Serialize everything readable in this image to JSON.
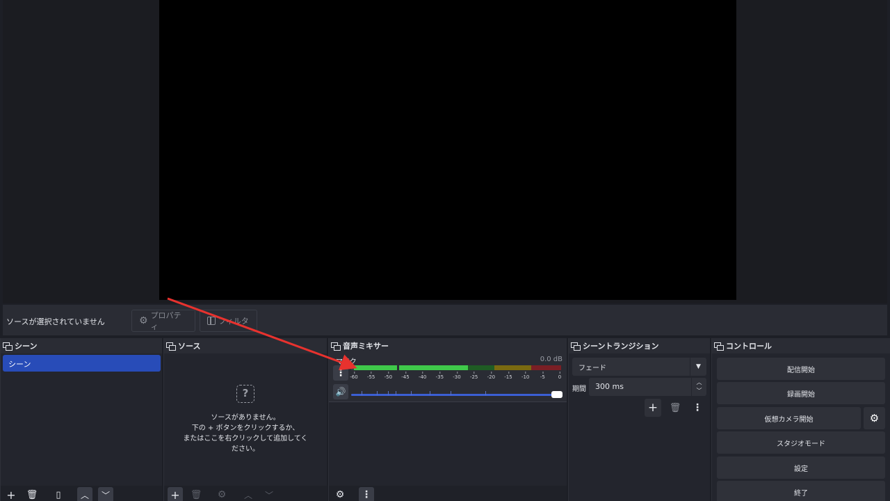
{
  "context_bar": {
    "no_source_text": "ソースが選択されていません",
    "properties_label": "プロパティ",
    "filters_label": "フィルタ"
  },
  "docks": {
    "scenes": {
      "title": "シーン",
      "items": [
        "シーン"
      ]
    },
    "sources": {
      "title": "ソース",
      "empty_lines": [
        "ソースがありません。",
        "下の + ボタンをクリックするか、",
        "またはここを右クリックして追加してく",
        "ださい。"
      ]
    },
    "mixer": {
      "title": "音声ミキサー",
      "channel": {
        "name": "マイク",
        "db": "0.0 dB",
        "volume_percent": 100
      },
      "ticks": [
        "-60",
        "-55",
        "-50",
        "-45",
        "-40",
        "-35",
        "-30",
        "-25",
        "-20",
        "-15",
        "-10",
        "-5",
        "0"
      ]
    },
    "transitions": {
      "title": "シーントランジション",
      "selected": "フェード",
      "duration_label": "期間",
      "duration_value": "300 ms"
    },
    "controls": {
      "title": "コントロール",
      "buttons": [
        "配信開始",
        "録画開始",
        "仮想カメラ開始",
        "スタジオモード",
        "設定",
        "終了"
      ]
    }
  },
  "colors": {
    "accent": "#284cb8",
    "meter_green": "#3fc94a",
    "meter_dark_green": "#1f5c24",
    "meter_yellow": "#7a6a10",
    "meter_red": "#7a1f25"
  }
}
